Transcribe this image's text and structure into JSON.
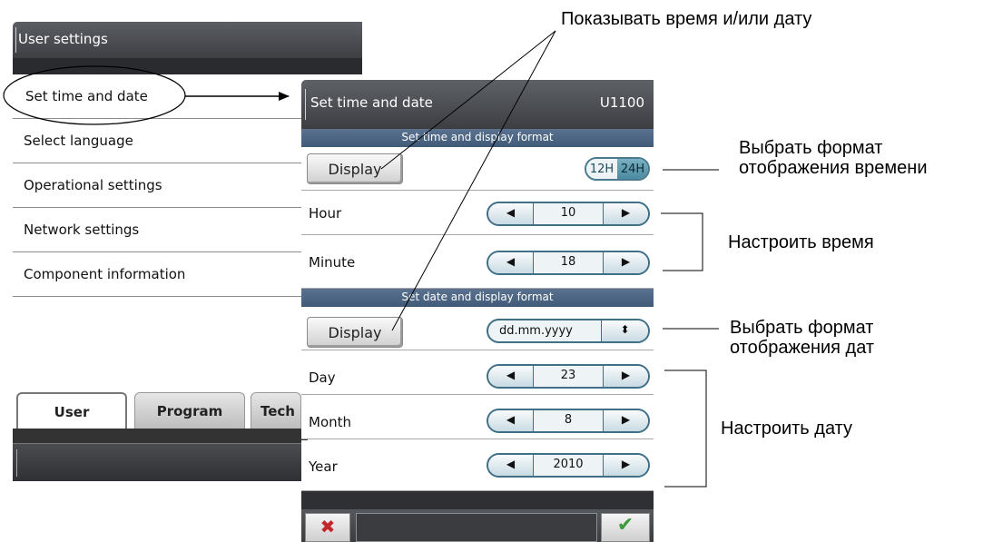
{
  "left_panel": {
    "title": "User settings",
    "menu": [
      {
        "label": "Set time and date"
      },
      {
        "label": "Select language"
      },
      {
        "label": "Operational settings"
      },
      {
        "label": "Network settings"
      },
      {
        "label": "Component information"
      }
    ],
    "tabs": [
      {
        "label": "User"
      },
      {
        "label": "Program"
      },
      {
        "label": "Tech"
      }
    ]
  },
  "right_panel": {
    "title": "Set time and date",
    "code": "U1100",
    "time_section": "Set time and display format",
    "display_label": "Display",
    "toggle": {
      "left": "12H",
      "right": "24H",
      "selected": "24H"
    },
    "hour": {
      "label": "Hour",
      "value": "10"
    },
    "minute": {
      "label": "Minute",
      "value": "18"
    },
    "date_section": "Set date and display format",
    "date_format": "dd.mm.yyyy",
    "day": {
      "label": "Day",
      "value": "23"
    },
    "month": {
      "label": "Month",
      "value": "8"
    },
    "year": {
      "label": "Year",
      "value": "2010"
    },
    "cancel_symbol": "✖",
    "ok_symbol": "✔"
  },
  "annotations": {
    "show_time_date": "Показывать время и/или дату",
    "time_format_line1": "Выбрать формат",
    "time_format_line2": "отображения времени",
    "set_time": "Настроить время",
    "date_format_line1": "Выбрать формат",
    "date_format_line2": "отображения дат",
    "set_date": "Настроить дату"
  },
  "icons": {
    "left_arrow": "◀",
    "right_arrow": "▶",
    "updown_arrow": "⬍"
  },
  "colors": {
    "section_header": "#4a6482",
    "toggle_selected": "#5e9ab0",
    "cancel": "#c0282b",
    "ok": "#3c9a3c"
  }
}
